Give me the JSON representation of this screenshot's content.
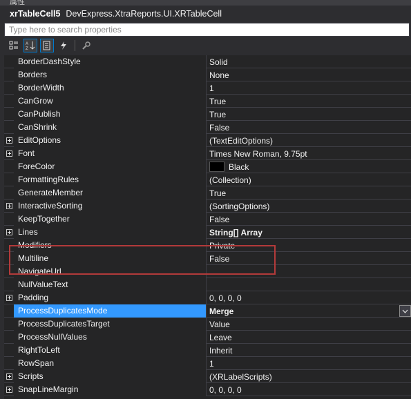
{
  "window": {
    "title": "属性"
  },
  "object": {
    "name": "xrTableCell5",
    "type": "DevExpress.XtraReports.UI.XRTableCell"
  },
  "search": {
    "placeholder": "Type here to search properties"
  },
  "toolbar": {
    "buttons": [
      {
        "icon": "categorized-icon",
        "active": false
      },
      {
        "icon": "alphabetical-icon",
        "active": true
      },
      {
        "icon": "properties-icon",
        "active": true
      },
      {
        "icon": "events-icon",
        "active": false
      },
      {
        "icon": "property-pages-icon",
        "active": false
      }
    ]
  },
  "properties": [
    {
      "name": "BorderDashStyle",
      "value": "Solid",
      "expandable": false,
      "bold": false
    },
    {
      "name": "Borders",
      "value": "None",
      "expandable": false,
      "bold": false
    },
    {
      "name": "BorderWidth",
      "value": "1",
      "expandable": false,
      "bold": false
    },
    {
      "name": "CanGrow",
      "value": "True",
      "expandable": false,
      "bold": false
    },
    {
      "name": "CanPublish",
      "value": "True",
      "expandable": false,
      "bold": false
    },
    {
      "name": "CanShrink",
      "value": "False",
      "expandable": false,
      "bold": false
    },
    {
      "name": "EditOptions",
      "value": "(TextEditOptions)",
      "expandable": true,
      "bold": false
    },
    {
      "name": "Font",
      "value": "Times New Roman, 9.75pt",
      "expandable": true,
      "bold": false
    },
    {
      "name": "ForeColor",
      "value": "Black",
      "expandable": false,
      "bold": false,
      "swatch": "#000000"
    },
    {
      "name": "FormattingRules",
      "value": "(Collection)",
      "expandable": false,
      "bold": false
    },
    {
      "name": "GenerateMember",
      "value": "True",
      "expandable": false,
      "bold": false
    },
    {
      "name": "InteractiveSorting",
      "value": "(SortingOptions)",
      "expandable": true,
      "bold": false
    },
    {
      "name": "KeepTogether",
      "value": "False",
      "expandable": false,
      "bold": false
    },
    {
      "name": "Lines",
      "value": "String[] Array",
      "expandable": true,
      "bold": true
    },
    {
      "name": "Modifiers",
      "value": "Private",
      "expandable": false,
      "bold": false
    },
    {
      "name": "Multiline",
      "value": "False",
      "expandable": false,
      "bold": false
    },
    {
      "name": "NavigateUrl",
      "value": "",
      "expandable": false,
      "bold": false
    },
    {
      "name": "NullValueText",
      "value": "",
      "expandable": false,
      "bold": false
    },
    {
      "name": "Padding",
      "value": "0, 0, 0, 0",
      "expandable": true,
      "bold": false
    },
    {
      "name": "ProcessDuplicatesMode",
      "value": "Merge",
      "expandable": false,
      "bold": true,
      "selected": true,
      "dropdown": true
    },
    {
      "name": "ProcessDuplicatesTarget",
      "value": "Value",
      "expandable": false,
      "bold": false
    },
    {
      "name": "ProcessNullValues",
      "value": "Leave",
      "expandable": false,
      "bold": false
    },
    {
      "name": "RightToLeft",
      "value": "Inherit",
      "expandable": false,
      "bold": false
    },
    {
      "name": "RowSpan",
      "value": "1",
      "expandable": false,
      "bold": false
    },
    {
      "name": "Scripts",
      "value": "(XRLabelScripts)",
      "expandable": true,
      "bold": false
    },
    {
      "name": "SnapLineMargin",
      "value": "0, 0, 0, 0",
      "expandable": true,
      "bold": false
    }
  ],
  "colors": {
    "selection": "#3399ff",
    "highlight_border": "#b33a3a",
    "background": "#252526"
  }
}
